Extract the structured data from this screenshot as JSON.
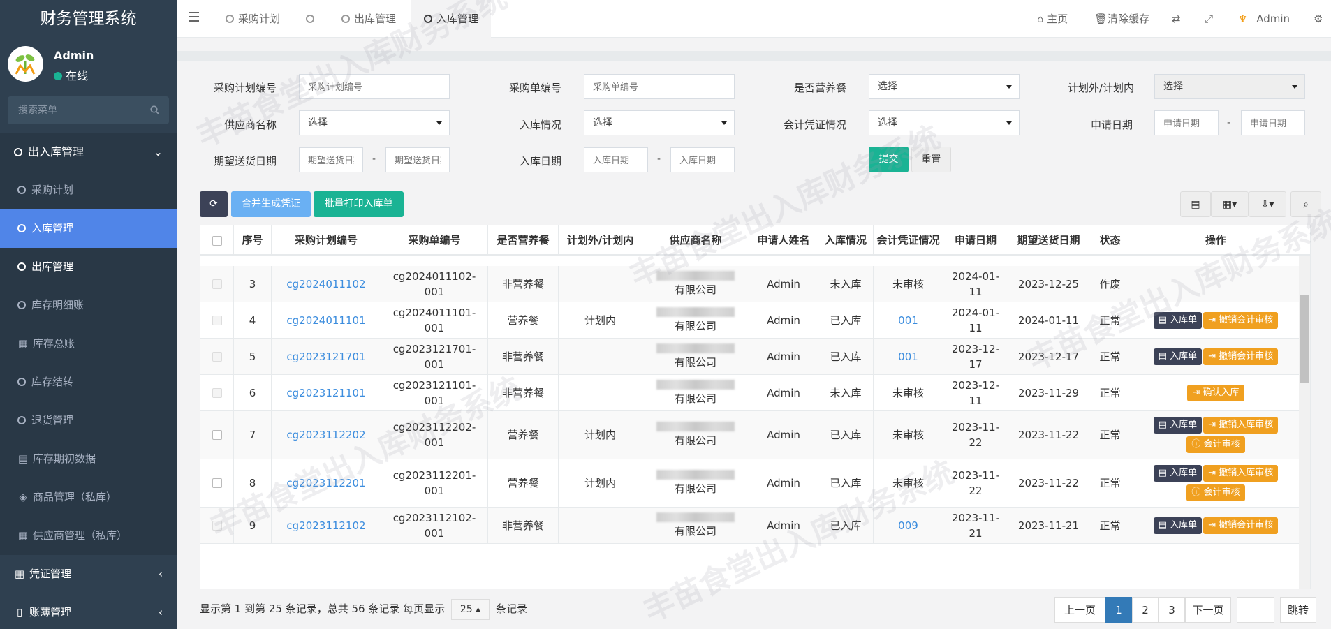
{
  "sidebar": {
    "brand": "财务管理系统",
    "user_name": "Admin",
    "user_status": "在线",
    "search_placeholder": "搜索菜单",
    "group1": "出入库管理",
    "items": [
      "采购计划",
      "入库管理",
      "出库管理",
      "库存明细账",
      "库存总账",
      "库存结转",
      "退货管理",
      "库存期初数据",
      "商品管理（私库）",
      "供应商管理（私库）"
    ],
    "group2": "凭证管理",
    "group3": "账薄管理"
  },
  "topbar": {
    "tabs": [
      "采购计划",
      "",
      "出库管理",
      "入库管理"
    ],
    "home": "主页",
    "clear_cache": "清除缓存",
    "user": "Admin"
  },
  "form": {
    "labels": {
      "plan_no": "采购计划编号",
      "order_no": "采购单编号",
      "nutrition": "是否营养餐",
      "plan_type": "计划外/计划内",
      "supplier": "供应商名称",
      "stock_in": "入库情况",
      "voucher": "会计凭证情况",
      "apply_date": "申请日期",
      "expect_date": "期望送货日期",
      "stock_in_date": "入库日期"
    },
    "placeholders": {
      "plan_no": "采购计划编号",
      "order_no": "采购单编号",
      "apply_date": "申请日期",
      "expect_date": "期望送货日期",
      "stock_in_date": "入库日期"
    },
    "select_text": "选择",
    "dash": "-",
    "submit": "提交",
    "reset": "重置"
  },
  "toolbar": {
    "merge": "合并生成凭证",
    "batch_print": "批量打印入库单"
  },
  "table": {
    "headers": [
      "序号",
      "采购计划编号",
      "采购单编号",
      "是否营养餐",
      "计划外/计划内",
      "供应商名称",
      "申请人姓名",
      "入库情况",
      "会计凭证情况",
      "申请日期",
      "期望送货日期",
      "状态",
      "操作"
    ],
    "rows": [
      {
        "no": "3",
        "plan": "cg2024011102",
        "order": "cg2024011102-001",
        "nut": "非营养餐",
        "type": "",
        "supplier": "有限公司",
        "applicant": "Admin",
        "stock": "未入库",
        "voucher": "未审核",
        "voucher_link": false,
        "apply": "2024-01-11",
        "expect": "2023-12-25",
        "status": "作废",
        "ops": []
      },
      {
        "no": "4",
        "plan": "cg2024011101",
        "order": "cg2024011101-001",
        "nut": "营养餐",
        "type": "计划内",
        "supplier": "有限公司",
        "applicant": "Admin",
        "stock": "已入库",
        "voucher": "001",
        "voucher_link": true,
        "apply": "2024-01-11",
        "expect": "2024-01-11",
        "status": "正常",
        "ops": [
          [
            "入库单",
            "dark"
          ],
          [
            "撤销会计审核",
            "orange"
          ]
        ]
      },
      {
        "no": "5",
        "plan": "cg2023121701",
        "order": "cg2023121701-001",
        "nut": "非营养餐",
        "type": "",
        "supplier": "有限公司",
        "applicant": "Admin",
        "stock": "已入库",
        "voucher": "001",
        "voucher_link": true,
        "apply": "2023-12-17",
        "expect": "2023-12-17",
        "status": "正常",
        "ops": [
          [
            "入库单",
            "dark"
          ],
          [
            "撤销会计审核",
            "orange"
          ]
        ]
      },
      {
        "no": "6",
        "plan": "cg2023121101",
        "order": "cg2023121101-001",
        "nut": "非营养餐",
        "type": "",
        "supplier": "有限公司",
        "applicant": "Admin",
        "stock": "未入库",
        "voucher": "未审核",
        "voucher_link": false,
        "apply": "2023-12-11",
        "expect": "2023-11-29",
        "status": "正常",
        "ops": [
          [
            "确认入库",
            "orange"
          ]
        ]
      },
      {
        "no": "7",
        "plan": "cg2023112202",
        "order": "cg2023112202-001",
        "nut": "营养餐",
        "type": "计划内",
        "supplier": "有限公司",
        "applicant": "Admin",
        "stock": "已入库",
        "voucher": "未审核",
        "voucher_link": false,
        "apply": "2023-11-22",
        "expect": "2023-11-22",
        "status": "正常",
        "ops": [
          [
            "入库单",
            "dark"
          ],
          [
            "撤销入库审核",
            "orange"
          ],
          [
            "会计审核",
            "orange"
          ]
        ]
      },
      {
        "no": "8",
        "plan": "cg2023112201",
        "order": "cg2023112201-001",
        "nut": "营养餐",
        "type": "计划内",
        "supplier": "有限公司",
        "applicant": "Admin",
        "stock": "已入库",
        "voucher": "未审核",
        "voucher_link": false,
        "apply": "2023-11-22",
        "expect": "2023-11-22",
        "status": "正常",
        "ops": [
          [
            "入库单",
            "dark"
          ],
          [
            "撤销入库审核",
            "orange"
          ],
          [
            "会计审核",
            "orange"
          ]
        ]
      },
      {
        "no": "9",
        "plan": "cg2023112102",
        "order": "cg2023112102-001",
        "nut": "非营养餐",
        "type": "",
        "supplier": "有限公司",
        "applicant": "Admin",
        "stock": "已入库",
        "voucher": "009",
        "voucher_link": true,
        "apply": "2023-11-21",
        "expect": "2023-11-21",
        "status": "正常",
        "ops": [
          [
            "入库单",
            "dark"
          ],
          [
            "撤销会计审核",
            "orange"
          ]
        ]
      }
    ]
  },
  "pagination": {
    "info": "显示第 1 到第 25 条记录，总共 56 条记录 每页显示",
    "page_size": "25",
    "suffix": "条记录",
    "prev": "上一页",
    "pages": [
      "1",
      "2",
      "3"
    ],
    "next": "下一页",
    "jump": "跳转"
  },
  "watermark_text": "丰苗食堂出入库财务系统",
  "colors": {
    "sidebar_bg": "#2f4050",
    "active_nav": "#5085e8",
    "green": "#1ab394",
    "blue_btn": "#6ab0f3",
    "orange": "#f0a020",
    "dark_btn": "#3c4257"
  }
}
